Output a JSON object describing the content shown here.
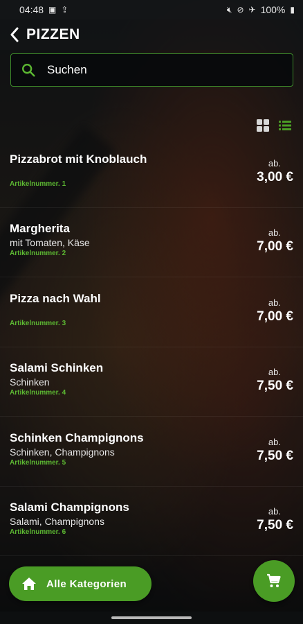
{
  "status_bar": {
    "time": "04:48",
    "battery": "100%"
  },
  "header": {
    "title": "PIZZEN"
  },
  "search": {
    "placeholder": "Suchen"
  },
  "items": [
    {
      "name": "Pizzabrot mit Knoblauch",
      "desc": "",
      "article_no": "Artikelnummer. 1",
      "price_prefix": "ab.",
      "price": "3,00 €"
    },
    {
      "name": "Margherita",
      "desc": "mit Tomaten, Käse",
      "article_no": "Artikelnummer. 2",
      "price_prefix": "ab.",
      "price": "7,00 €"
    },
    {
      "name": "Pizza nach Wahl",
      "desc": "",
      "article_no": "Artikelnummer. 3",
      "price_prefix": "ab.",
      "price": "7,00 €"
    },
    {
      "name": "Salami Schinken",
      "desc": "Schinken",
      "article_no": "Artikelnummer. 4",
      "price_prefix": "ab.",
      "price": "7,50 €"
    },
    {
      "name": "Schinken Champignons",
      "desc": "Schinken, Champignons",
      "article_no": "Artikelnummer. 5",
      "price_prefix": "ab.",
      "price": "7,50 €"
    },
    {
      "name": "Salami Champignons",
      "desc": "Salami, Champignons",
      "article_no": "Artikelnummer. 6",
      "price_prefix": "ab.",
      "price": "7,50 €"
    }
  ],
  "bottom": {
    "categories_label": "Alle Kategorien"
  },
  "colors": {
    "accent": "#4a9c25",
    "article_no": "#5cb832"
  }
}
